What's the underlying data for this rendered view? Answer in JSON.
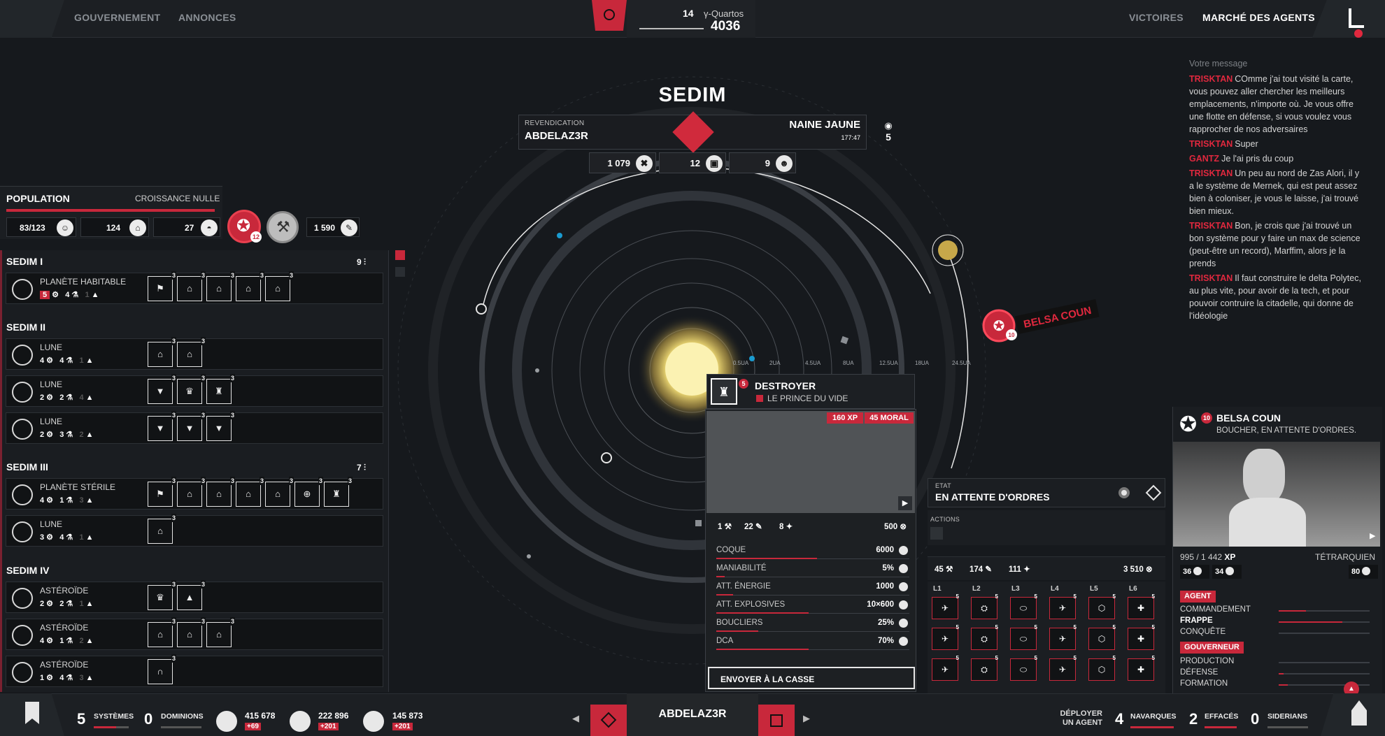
{
  "topbar": {
    "left_nav": [
      "GOUVERNEMENT",
      "ANNONCES"
    ],
    "right_nav": [
      "VICTOIRES",
      "MARCHÉ DES AGENTS"
    ],
    "cycle_number": "14",
    "cycle_label": "γ-Quartos",
    "year": "4036"
  },
  "system": {
    "name": "SEDIM",
    "claim_label": "REVENDICATION",
    "claim_owner": "ABDELAZ3R",
    "star_type": "NAINE JAUNE",
    "star_coord": "177:47",
    "visibility": "5",
    "resources": [
      "1 079",
      "12",
      "9"
    ],
    "distances": [
      "0.5UA",
      "2UA",
      "4.5UA",
      "8UA",
      "12.5UA",
      "18UA",
      "24.5UA"
    ],
    "enemy_fleet": "BELSA COUN",
    "enemy_fleet_level": "10"
  },
  "population": {
    "title": "POPULATION",
    "growth": "CROISSANCE NULLE",
    "values": [
      "83/123",
      "124",
      "27"
    ],
    "agent_count": "12",
    "extra": "1 590"
  },
  "planets": [
    {
      "system": "SEDIM I",
      "count": "9",
      "bodies": [
        {
          "type": "PLANÈTE HABITABLE",
          "stats": [
            "5",
            "4",
            "1"
          ],
          "buildings": [
            "⚑",
            "⌂",
            "⌂",
            "⌂",
            "⌂"
          ]
        }
      ]
    },
    {
      "system": "SEDIM II",
      "bodies": [
        {
          "type": "LUNE",
          "stats": [
            "4",
            "4",
            "1"
          ],
          "buildings": [
            "⌂",
            "⌂"
          ]
        },
        {
          "type": "LUNE",
          "stats": [
            "2",
            "2",
            "4"
          ],
          "buildings": [
            "▼",
            "♛",
            "♜"
          ]
        },
        {
          "type": "LUNE",
          "stats": [
            "2",
            "3",
            "2"
          ],
          "buildings": [
            "▼",
            "▼",
            "▼"
          ]
        }
      ]
    },
    {
      "system": "SEDIM III",
      "count": "7",
      "bodies": [
        {
          "type": "PLANÈTE STÉRILE",
          "stats": [
            "4",
            "1",
            "3"
          ],
          "buildings": [
            "⚑",
            "⌂",
            "⌂",
            "⌂",
            "⌂",
            "⊕",
            "♜"
          ]
        },
        {
          "type": "LUNE",
          "stats": [
            "3",
            "4",
            "1"
          ],
          "buildings": [
            "⌂"
          ]
        }
      ]
    },
    {
      "system": "SEDIM IV",
      "bodies": [
        {
          "type": "ASTÉROÏDE",
          "stats": [
            "2",
            "2",
            "1"
          ],
          "buildings": [
            "♛",
            "▲"
          ]
        },
        {
          "type": "ASTÉROÏDE",
          "stats": [
            "4",
            "1",
            "2"
          ],
          "buildings": [
            "⌂",
            "⌂",
            "⌂"
          ]
        },
        {
          "type": "ASTÉROÏDE",
          "stats": [
            "1",
            "4",
            "3"
          ],
          "buildings": [
            "∩"
          ]
        }
      ]
    }
  ],
  "chat": {
    "placeholder": "Votre message",
    "messages": [
      {
        "author": "TRISKTAN",
        "text": "COmme j'ai tout visité la carte, vous pouvez aller chercher les meilleurs emplacements, n'importe où. Je vous offre une flotte en défense, si vous voulez vous rapprocher de nos adversaires"
      },
      {
        "author": "TRISKTAN",
        "text": "Super"
      },
      {
        "author": "GANTZ",
        "text": "Je l'ai pris du coup"
      },
      {
        "author": "TRISKTAN",
        "text": "Un peu au nord de Zas Alori, il y a le système de Mernek, qui est peut assez bien à coloniser, je vous le laisse, j'ai trouvé bien mieux."
      },
      {
        "author": "TRISKTAN",
        "text": "Bon, je crois que j'ai trouvé un bon système pour y faire un max de science (peut-être un record), Marffim, alors je la prends"
      },
      {
        "author": "TRISKTAN",
        "text": "Il faut construire le delta Polytec, au plus vite, pour avoir de la tech, et pour pouvoir contruire la citadelle, qui donne de l'idéologie"
      }
    ]
  },
  "ship": {
    "class": "DESTROYER",
    "level": "5",
    "owner": "LE PRINCE DU VIDE",
    "xp": "160 XP",
    "moral": "45 MORAL",
    "res": [
      "1",
      "22",
      "8",
      "500"
    ],
    "stats": [
      {
        "label": "COQUE",
        "value": "6000",
        "fill": 0.6
      },
      {
        "label": "MANIABILITÉ",
        "value": "5%",
        "fill": 0.05
      },
      {
        "label": "ATT. ÉNERGIE",
        "value": "1000",
        "fill": 0.1
      },
      {
        "label": "ATT. EXPLOSIVES",
        "value": "10×600",
        "fill": 0.55
      },
      {
        "label": "BOUCLIERS",
        "value": "25%",
        "fill": 0.25
      },
      {
        "label": "DCA",
        "value": "70%",
        "fill": 0.55
      }
    ],
    "scrap_label": "ENVOYER À LA CASSE"
  },
  "fleet": {
    "state_label": "ETAT",
    "state_value": "EN ATTENTE D'ORDRES",
    "actions_label": "ACTIONS",
    "res": [
      "45",
      "174",
      "111",
      "3 510"
    ],
    "lanes": [
      "L1",
      "L2",
      "L3",
      "L4",
      "L5",
      "L6"
    ]
  },
  "agent": {
    "level": "10",
    "name": "BELSA COUN",
    "status": "BOUCHER, EN ATTENTE D'ORDRES.",
    "xp": "995 / 1 442",
    "xp_unit": "XP",
    "rank": "TÉTRARQUIEN",
    "stat_a": "36",
    "stat_b": "34",
    "stat_c": "80",
    "skills": {
      "agent_tag": "AGENT",
      "agent_skills": [
        {
          "label": "COMMANDEMENT",
          "fill": 0.3,
          "bold": false
        },
        {
          "label": "FRAPPE",
          "fill": 0.7,
          "bold": true
        },
        {
          "label": "CONQUÊTE",
          "fill": 0.0,
          "bold": false
        }
      ],
      "gov_tag": "GOUVERNEUR",
      "gov_skills": [
        {
          "label": "PRODUCTION",
          "fill": 0.0
        },
        {
          "label": "DÉFENSE",
          "fill": 0.05
        },
        {
          "label": "FORMATION",
          "fill": 0.1
        }
      ]
    }
  },
  "bottombar": {
    "systems": "5",
    "systems_label": "SYSTÈMES",
    "dominions": "0",
    "dominions_label": "DOMINIONS",
    "res1": "415 678",
    "res1_delta": "+69",
    "res2": "222 896",
    "res2_delta": "+201",
    "res3": "145 873",
    "res3_delta": "+201",
    "empire": "ABDELAZ3R",
    "deploy_label_1": "DÉPLOYER",
    "deploy_label_2": "UN AGENT",
    "navarques": "4",
    "navarques_label": "NAVARQUES",
    "effaces": "2",
    "effaces_label": "EFFACÉS",
    "siderians": "0",
    "siderians_label": "SIDERIANS"
  },
  "colors": {
    "accent": "#c8283b",
    "background": "#16191d",
    "star": "#f6e27a"
  }
}
